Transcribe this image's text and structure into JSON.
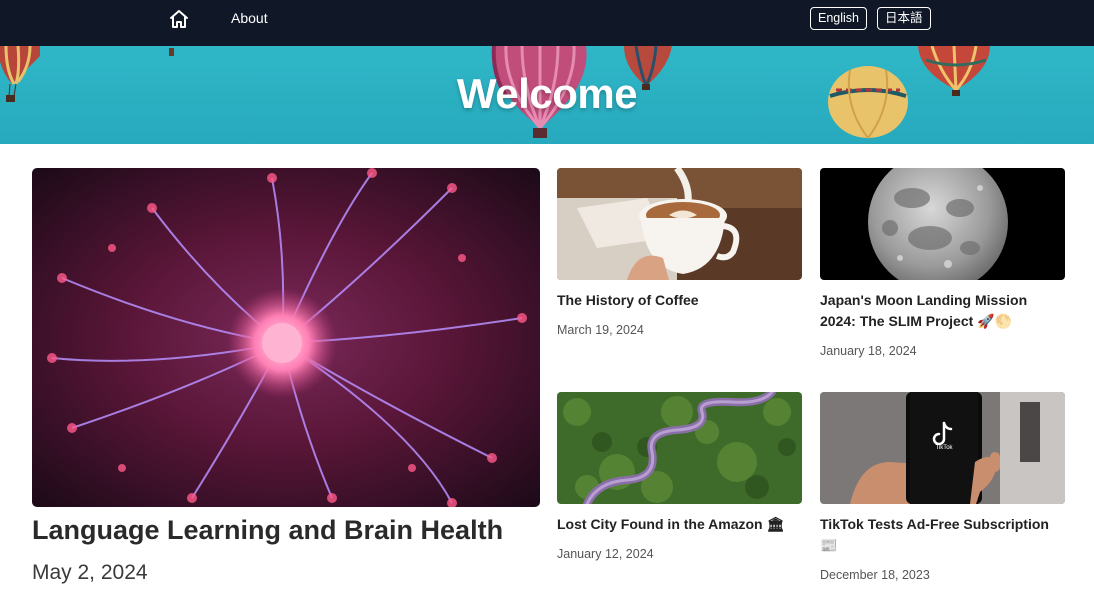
{
  "nav": {
    "home_icon": "home-icon",
    "about_label": "About",
    "lang_english": "English",
    "lang_japanese": "日本語"
  },
  "hero": {
    "title": "Welcome"
  },
  "featured": {
    "title": "Language Learning and Brain Health",
    "date": "May 2, 2024"
  },
  "cards": [
    {
      "title": "The History of Coffee",
      "date": "March 19, 2024"
    },
    {
      "title": "Japan's Moon Landing Mission 2024: The SLIM Project 🚀🌕",
      "date": "January 18, 2024"
    },
    {
      "title": "Lost City Found in the Amazon 🏛",
      "date": "January 12, 2024"
    },
    {
      "title": "TikTok Tests Ad-Free Subscription 📰",
      "date": "December 18, 2023"
    }
  ],
  "colors": {
    "nav_bg": "#101828",
    "hero_bg": "#2fb7c7"
  }
}
